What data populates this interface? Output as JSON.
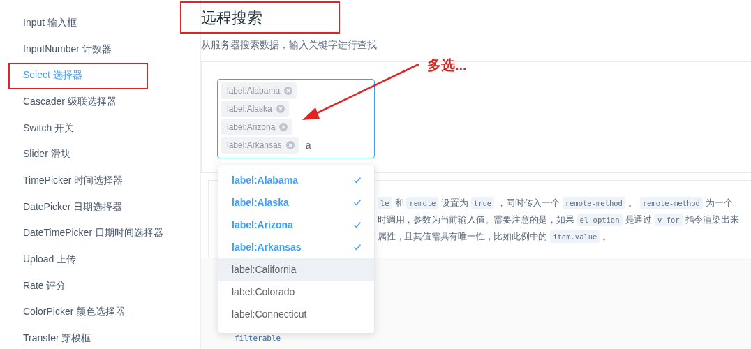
{
  "sidebar": {
    "items": [
      {
        "label": "Input 输入框",
        "selected": false
      },
      {
        "label": "InputNumber 计数器",
        "selected": false
      },
      {
        "label": "Select 选择器",
        "selected": true
      },
      {
        "label": "Cascader 级联选择器",
        "selected": false
      },
      {
        "label": "Switch 开关",
        "selected": false
      },
      {
        "label": "Slider 滑块",
        "selected": false
      },
      {
        "label": "TimePicker 时间选择器",
        "selected": false
      },
      {
        "label": "DatePicker 日期选择器",
        "selected": false
      },
      {
        "label": "DateTimePicker 日期时间选择器",
        "selected": false
      },
      {
        "label": "Upload 上传",
        "selected": false
      },
      {
        "label": "Rate 评分",
        "selected": false
      },
      {
        "label": "ColorPicker 颜色选择器",
        "selected": false
      },
      {
        "label": "Transfer 穿梭框",
        "selected": false
      }
    ]
  },
  "section": {
    "title": "远程搜索",
    "subtitle": "从服务器搜索数据，输入关键字进行查找"
  },
  "select": {
    "tags": [
      "label:Alabama",
      "label:Alaska",
      "label:Arizona",
      "label:Arkansas"
    ],
    "value": "a"
  },
  "dropdown": {
    "options": [
      {
        "label": "label:Alabama",
        "selected": true,
        "hovered": false
      },
      {
        "label": "label:Alaska",
        "selected": true,
        "hovered": false
      },
      {
        "label": "label:Arizona",
        "selected": true,
        "hovered": false
      },
      {
        "label": "label:Arkansas",
        "selected": true,
        "hovered": false
      },
      {
        "label": "label:California",
        "selected": false,
        "hovered": true
      },
      {
        "label": "label:Colorado",
        "selected": false,
        "hovered": false
      },
      {
        "label": "label:Connecticut",
        "selected": false,
        "hovered": false
      }
    ]
  },
  "description": {
    "lines": [
      [
        {
          "kind": "code",
          "text": "le"
        },
        {
          "kind": "text",
          "text": "和"
        },
        {
          "kind": "code",
          "text": "remote"
        },
        {
          "kind": "text",
          "text": "设置为"
        },
        {
          "kind": "code",
          "text": "true"
        },
        {
          "kind": "text",
          "text": "，同时传入一个"
        },
        {
          "kind": "code",
          "text": "remote-method"
        },
        {
          "kind": "text",
          "text": "。"
        },
        {
          "kind": "code",
          "text": "remote-method"
        },
        {
          "kind": "text",
          "text": "为一个"
        }
      ],
      [
        {
          "kind": "text",
          "text": "时调用，参数为当前输入值。需要注意的是，如果"
        },
        {
          "kind": "code",
          "text": "el-option"
        },
        {
          "kind": "text",
          "text": "是通过"
        },
        {
          "kind": "code",
          "text": "v-for"
        },
        {
          "kind": "text",
          "text": "指令渲染出来"
        }
      ],
      [
        {
          "kind": "text",
          "text": "属性，且其值需具有唯一性，比如此例中的"
        },
        {
          "kind": "code",
          "text": "item.value"
        },
        {
          "kind": "text",
          "text": "。"
        }
      ]
    ]
  },
  "code": {
    "text": "filterable"
  },
  "annotation": {
    "text": "多选..."
  }
}
